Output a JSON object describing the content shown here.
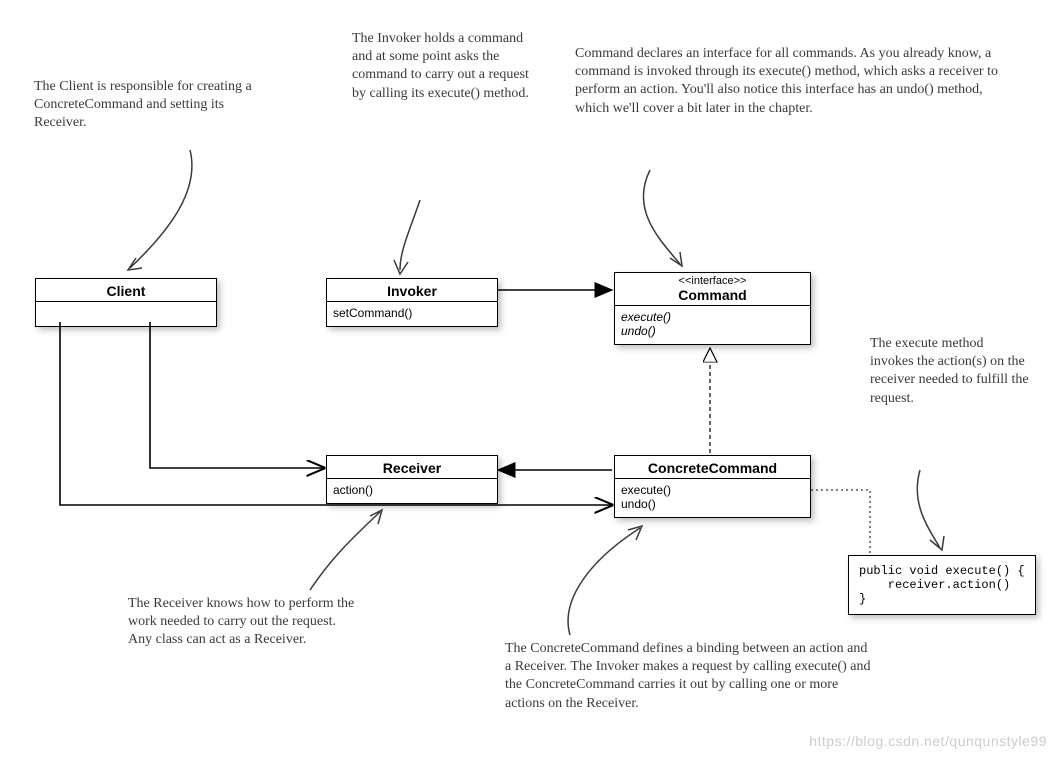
{
  "annotations": {
    "client": "The Client is responsible for creating a ConcreteCommand and setting its Receiver.",
    "invoker": "The Invoker holds a command and at some point asks the command to carry out a request by calling its execute() method.",
    "command": "Command declares an interface for all commands. As you already know, a command is invoked through its execute() method, which asks a receiver to perform an action.  You'll also notice this interface has an undo() method, which we'll cover a bit later in the chapter.",
    "execute": "The execute method invokes the action(s) on the receiver needed to fulfill the request.",
    "receiver": "The Receiver knows how to perform the work needed to carry out the request.  Any class can act as a Receiver.",
    "concrete": "The ConcreteCommand defines a binding between an action and a Receiver.  The Invoker makes a request by calling execute() and the ConcreteCommand carries it out by calling one or more actions on the Receiver."
  },
  "classes": {
    "client": {
      "name": "Client"
    },
    "invoker": {
      "name": "Invoker",
      "m1": "setCommand()"
    },
    "command": {
      "stereo": "<<interface>>",
      "name": "Command",
      "m1": "execute()",
      "m2": "undo()"
    },
    "receiver": {
      "name": "Receiver",
      "m1": "action()"
    },
    "concrete": {
      "name": "ConcreteCommand",
      "m1": "execute()",
      "m2": "undo()"
    }
  },
  "code": {
    "line1": "public void execute() {",
    "line2": "    receiver.action()",
    "line3": "}"
  },
  "watermark": "https://blog.csdn.net/qunqunstyle99"
}
